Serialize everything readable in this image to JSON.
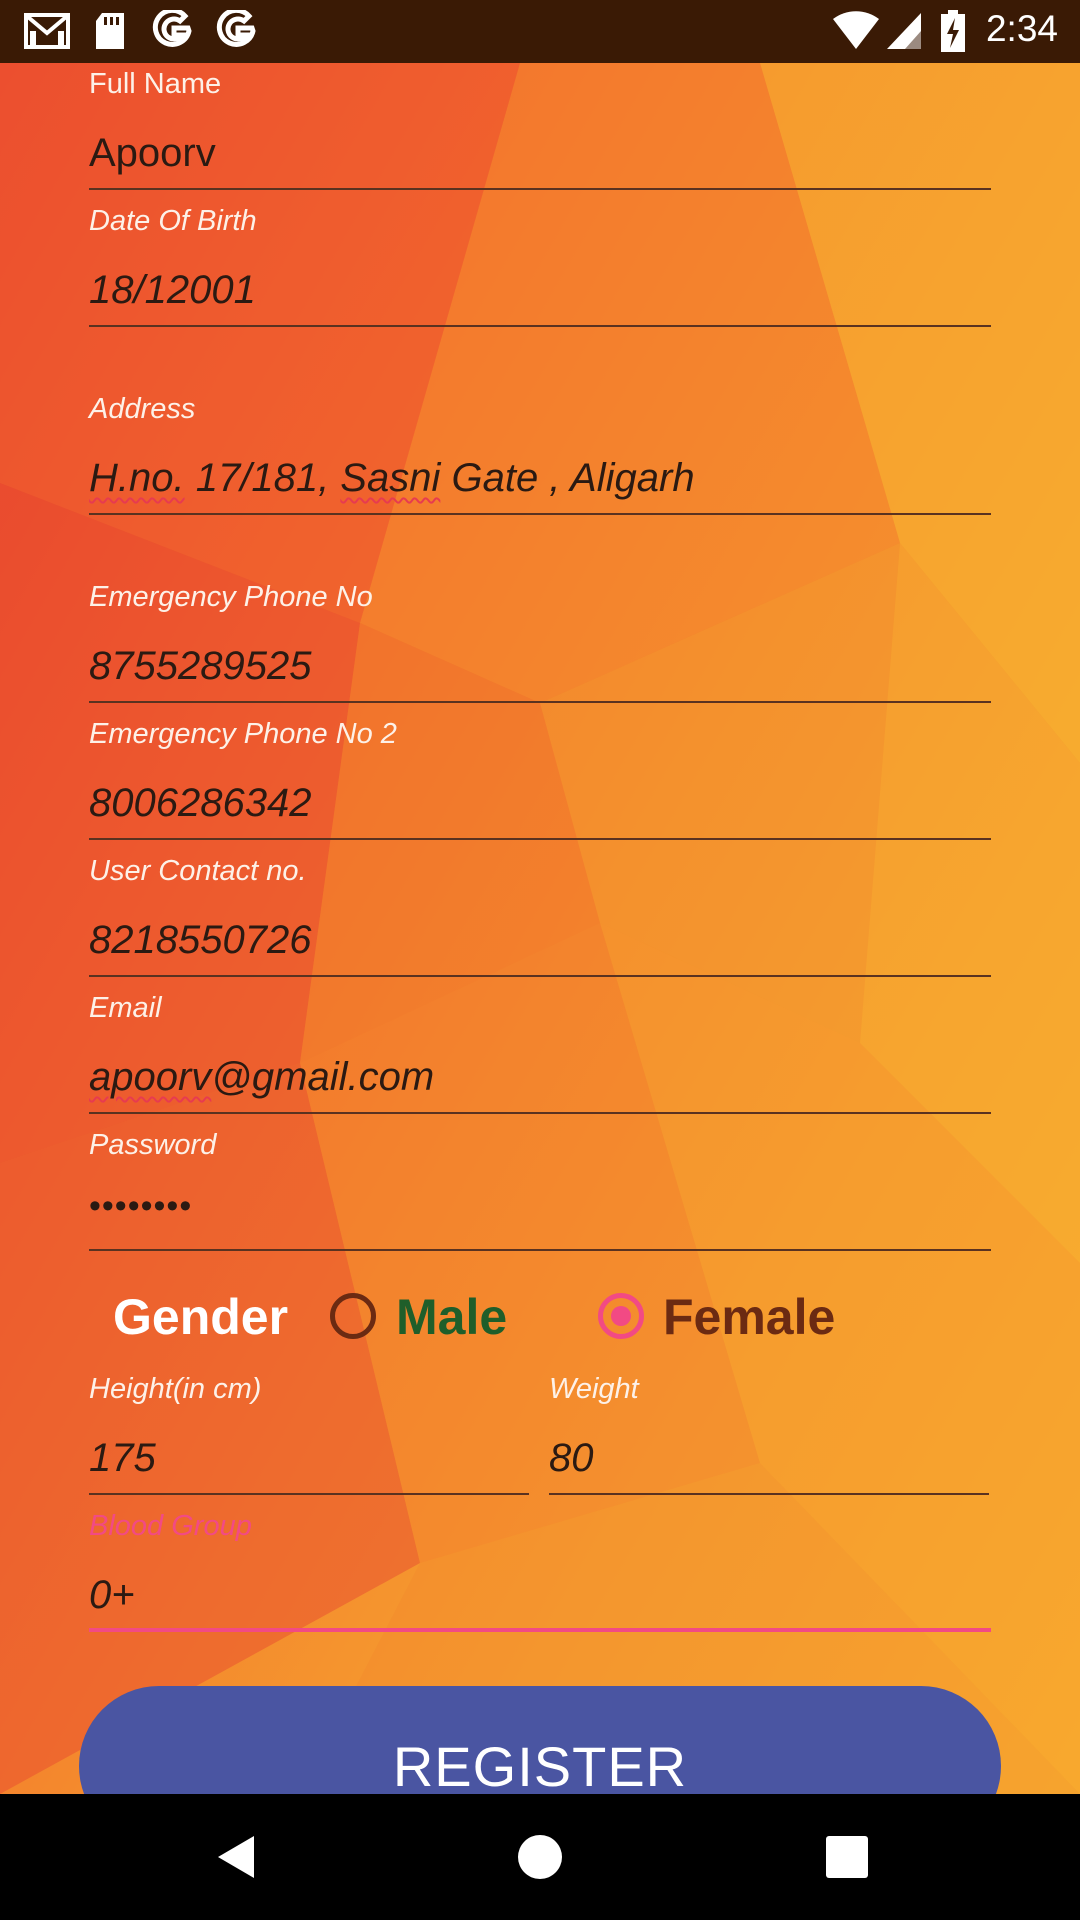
{
  "status_bar": {
    "time": "2:34",
    "left_icons": [
      "gmail-icon",
      "sd-card-icon",
      "google-icon",
      "google-icon"
    ],
    "right_icons": [
      "wifi-icon",
      "signal-icon",
      "battery-charging-icon"
    ]
  },
  "form": {
    "full_name": {
      "label": "Full Name",
      "value": "Apoorv"
    },
    "dob": {
      "label": "Date Of Birth",
      "value": "18/12001"
    },
    "address": {
      "label": "Address",
      "value_parts": [
        "H.no.",
        " 17/181, ",
        "Sasni",
        " Gate , Aligarh"
      ]
    },
    "emergency1": {
      "label": "Emergency Phone No",
      "value": "8755289525"
    },
    "emergency2": {
      "label": "Emergency Phone No 2",
      "value": "8006286342"
    },
    "contact": {
      "label": "User Contact no.",
      "value": "8218550726"
    },
    "email": {
      "label": "Email",
      "value_parts": [
        "apoorv",
        "@gmail.com"
      ]
    },
    "password": {
      "label": "Password",
      "value": "••••••••"
    },
    "gender": {
      "label": "Gender",
      "options": [
        {
          "label": "Male",
          "selected": false,
          "color": "#1f5e2a"
        },
        {
          "label": "Female",
          "selected": true,
          "color": "#6b2a12"
        }
      ]
    },
    "height": {
      "label": "Height(in cm)",
      "value": "175"
    },
    "weight": {
      "label": "Weight",
      "value": "80"
    },
    "blood_group": {
      "label": "Blood Group",
      "value": "0+",
      "focused": true
    }
  },
  "register_button": {
    "label": "REGISTER"
  },
  "colors": {
    "accent": "#f24a84",
    "button": "#4a55a2",
    "status_bar": "#3a1a05"
  },
  "nav_bar": {
    "buttons": [
      "back-icon",
      "home-icon",
      "recents-icon"
    ]
  }
}
